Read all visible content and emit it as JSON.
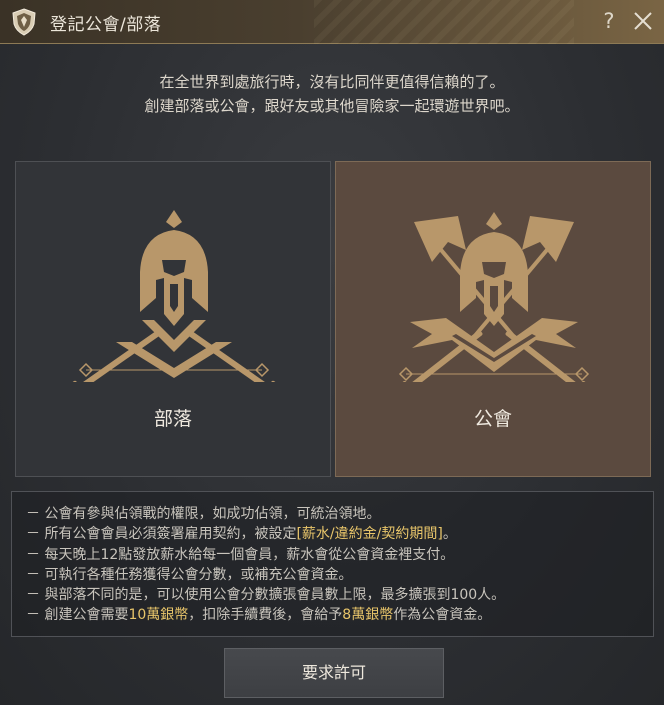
{
  "window": {
    "title": "登記公會/部落"
  },
  "intro": {
    "line1": "在全世界到處旅行時，沒有比同伴更值得信賴的了。",
    "line2": "創建部落或公會，跟好友或其他冒險家一起環遊世界吧。"
  },
  "options": {
    "tribe": {
      "label": "部落",
      "selected": false
    },
    "guild": {
      "label": "公會",
      "selected": true
    }
  },
  "info": {
    "l1": "－ 公會有參與佔領戰的權限，如成功佔領，可統治領地。",
    "l2a": "－ 所有公會會員必須簽署雇用契約，被設定",
    "l2b": "[薪水/違約金/契約期間]",
    "l2c": "。",
    "l3": "－ 每天晚上12點發放薪水給每一個會員，薪水會從公會資金裡支付。",
    "l4": "－ 可執行各種任務獲得公會分數，或補充公會資金。",
    "l5": "－ 與部落不同的是，可以使用公會分數擴張會員數上限，最多擴張到100人。",
    "l6a": "－ 創建公會需要",
    "l6b": "10萬銀幣",
    "l6c": "，扣除手續費後，會給予",
    "l6d": "8萬銀幣",
    "l6e": "作為公會資金。"
  },
  "button": {
    "label": "要求許可"
  },
  "icons": {
    "title": "shield-emblem-icon",
    "help": "question-mark-icon",
    "close": "close-icon",
    "tribe": "tribe-helmet-swords-emblem",
    "guild": "guild-helmet-flags-emblem"
  },
  "colors": {
    "highlight": "#e8c56a",
    "emblem": "#b8976a",
    "selected_card": "#5b4a3f"
  }
}
